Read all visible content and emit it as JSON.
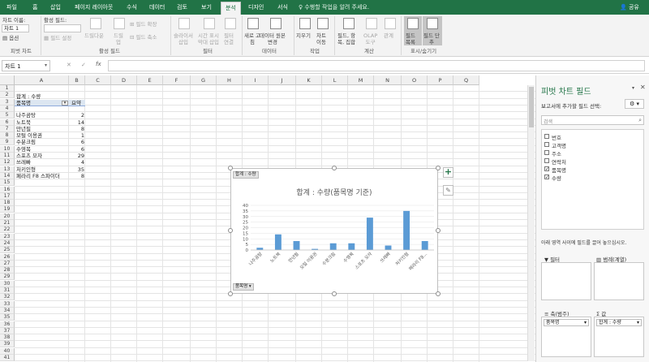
{
  "tabs": [
    "파일",
    "홈",
    "삽입",
    "페이지 레이아웃",
    "수식",
    "데이터",
    "검토",
    "보기",
    "분석",
    "디자인",
    "서식"
  ],
  "active_tab": "분석",
  "tell_me": "수행할 작업을 알려 주세요.",
  "share": "공유",
  "ribbon": {
    "chart_name_label": "차트 이름:",
    "chart_name_value": "차트 1",
    "options": "옵션",
    "pivot_chart_group": "피벗 차트",
    "active_field_label": "활성 필드:",
    "field_settings": "필드 설정",
    "drill_down": "드릴다운",
    "drill_up": "드릴\n업",
    "expand_field": "필드 확장",
    "collapse_field": "필드 축소",
    "active_field_group": "활성 필드",
    "insert_slicer": "슬라이서\n삽입",
    "insert_timeline": "시간 표시\n막대 삽입",
    "filter_connections": "필터\n연결",
    "filter_group": "필터",
    "refresh": "새로 고\n침",
    "change_source": "데이터 원본\n변경",
    "data_group": "데이터",
    "clear": "지우기",
    "move_chart": "차트\n이동",
    "actions_group": "작업",
    "fields_items": "필드, 항\n목, 집합",
    "olap_tools": "OLAP\n도구",
    "relationships": "관계",
    "calc_group": "계산",
    "field_list": "필드\n목록",
    "field_buttons": "필드 단\n추",
    "show_hide_group": "표시/숨기기"
  },
  "formula_bar": {
    "name_box": "차트 1",
    "cancel": "✕",
    "enter": "✓",
    "fx": "fx"
  },
  "columns": [
    "A",
    "B",
    "C",
    "D",
    "E",
    "F",
    "G",
    "H",
    "I",
    "J",
    "K",
    "L",
    "M",
    "N",
    "O",
    "P",
    "Q"
  ],
  "rows": [
    "1",
    "2",
    "3",
    "4",
    "5",
    "6",
    "7",
    "8",
    "9",
    "10",
    "11",
    "12",
    "13",
    "14",
    "15",
    "16",
    "17",
    "18",
    "19",
    "20",
    "21",
    "22",
    "23",
    "24",
    "25",
    "26",
    "27",
    "28",
    "29",
    "30",
    "31",
    "32",
    "33",
    "34",
    "35",
    "36",
    "37",
    "38",
    "39",
    "40",
    "41"
  ],
  "pivot_table": {
    "title": "합계 : 수량",
    "header_label": "품목명",
    "header_value": "요약",
    "rows": [
      {
        "name": "나주곰탕",
        "value": "2"
      },
      {
        "name": "노트북",
        "value": "14"
      },
      {
        "name": "만년필",
        "value": "8"
      },
      {
        "name": "모털 이용권",
        "value": "1"
      },
      {
        "name": "수분크림",
        "value": "6"
      },
      {
        "name": "수영복",
        "value": "6"
      },
      {
        "name": "스포츠 모자",
        "value": "29"
      },
      {
        "name": "쓰레빠",
        "value": "4"
      },
      {
        "name": "처키인형",
        "value": "35"
      },
      {
        "name": "페라리 F8 스파이더",
        "value": "8"
      }
    ]
  },
  "chart_data": {
    "type": "bar",
    "title": "합계 : 수량(품목명 기준)",
    "categories": [
      "나주곰탕",
      "노트북",
      "만년필",
      "모털 이용권",
      "수분크림",
      "수영복",
      "스포츠 모자",
      "쓰레빠",
      "처키인형",
      "페라리 F8..."
    ],
    "values": [
      2,
      14,
      8,
      1,
      6,
      6,
      29,
      4,
      35,
      8
    ],
    "ylim": [
      0,
      40
    ],
    "yticks": [
      "0",
      "5",
      "10",
      "15",
      "20",
      "25",
      "30",
      "35",
      "40"
    ],
    "color": "#5b9bd5",
    "field_button_top": "합계 : 수량",
    "field_button_bottom": "품목명",
    "legend": "none",
    "grid": true
  },
  "field_pane": {
    "title": "피벗 차트 필드",
    "subtitle": "보고서에 추가할 필드 선택:",
    "search_placeholder": "검색",
    "fields": [
      {
        "name": "번호",
        "checked": false
      },
      {
        "name": "고객명",
        "checked": false
      },
      {
        "name": "주소",
        "checked": false
      },
      {
        "name": "연락처",
        "checked": false
      },
      {
        "name": "품목명",
        "checked": true
      },
      {
        "name": "수량",
        "checked": true
      }
    ],
    "drag_hint": "아래 영역 사이에 필드를 끌어 놓으십시오.",
    "filter_label": "필터",
    "legend_label": "범례(계열)",
    "axis_label": "축(범주)",
    "values_label": "값",
    "axis_item": "품목명",
    "values_item": "합계 : 수량"
  },
  "colors": {
    "brand": "#217346",
    "bar": "#5b9bd5"
  }
}
